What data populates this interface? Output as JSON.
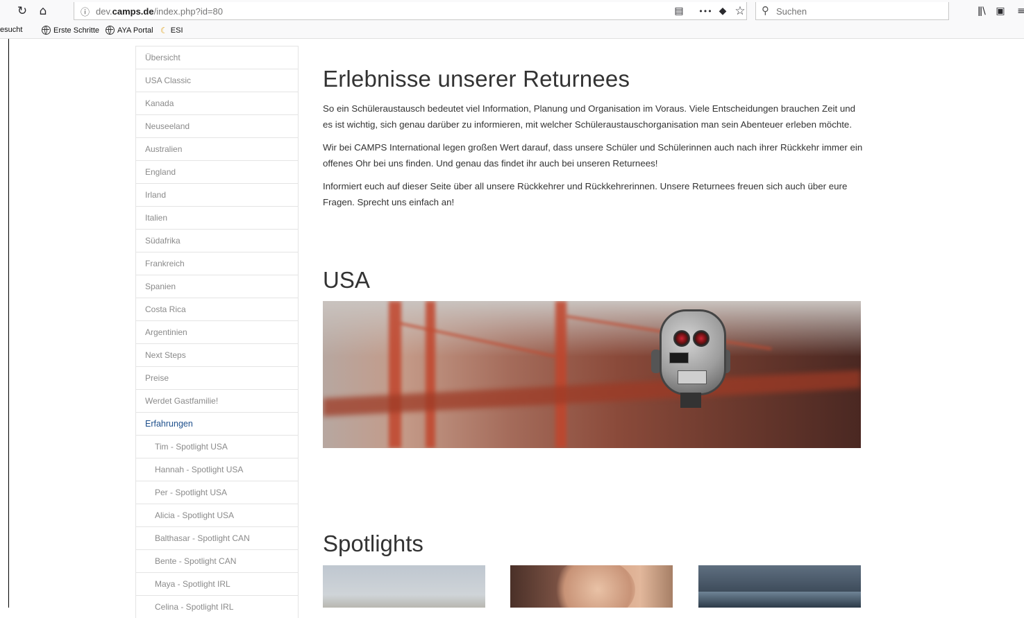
{
  "browser": {
    "url_prefix": "dev.",
    "url_domain": "camps.de",
    "url_path": "/index.php?id=80",
    "search_placeholder": "Suchen",
    "icons": {
      "reload": "↻",
      "home": "⌂",
      "info": "ⓘ",
      "reader": "▤",
      "more": "•••",
      "pocket": "◆",
      "star": "☆",
      "search": "⚲",
      "library": "ǁ\\",
      "sidebar": "▣",
      "menu": "≡"
    },
    "bookmarks": [
      {
        "label": "esucht"
      },
      {
        "label": "Erste Schritte"
      },
      {
        "label": "AYA Portal"
      },
      {
        "label": "ESI"
      }
    ]
  },
  "sidebar": {
    "items": [
      {
        "label": "Übersicht"
      },
      {
        "label": "USA Classic"
      },
      {
        "label": "Kanada"
      },
      {
        "label": "Neuseeland"
      },
      {
        "label": "Australien"
      },
      {
        "label": "England"
      },
      {
        "label": "Irland"
      },
      {
        "label": "Italien"
      },
      {
        "label": "Südafrika"
      },
      {
        "label": "Frankreich"
      },
      {
        "label": "Spanien"
      },
      {
        "label": "Costa Rica"
      },
      {
        "label": "Argentinien"
      },
      {
        "label": "Next Steps"
      },
      {
        "label": "Preise"
      },
      {
        "label": "Werdet Gastfamilie!"
      },
      {
        "label": "Erfahrungen"
      }
    ],
    "subitems": [
      {
        "label": "Tim - Spotlight USA"
      },
      {
        "label": "Hannah - Spotlight USA"
      },
      {
        "label": "Per - Spotlight USA"
      },
      {
        "label": "Alicia - Spotlight USA"
      },
      {
        "label": "Balthasar - Spotlight CAN"
      },
      {
        "label": "Bente - Spotlight CAN"
      },
      {
        "label": "Maya - Spotlight IRL"
      },
      {
        "label": "Celina - Spotlight IRL"
      }
    ],
    "active_item": "Erfahrungen"
  },
  "main": {
    "title": "Erlebnisse unserer Returnees",
    "paragraphs": [
      "So ein Schüleraustausch bedeutet viel Information, Planung und Organisation im Voraus. Viele Entscheidungen brauchen Zeit und es ist wichtig, sich genau darüber zu informieren, mit welcher Schüleraustauschorganisation man sein Abenteuer erleben möchte.",
      "Wir bei CAMPS International legen großen Wert darauf, dass unsere Schüler und Schülerinnen auch nach ihrer Rückkehr immer ein offenes Ohr bei uns finden. Und genau das findet ihr auch bei unseren Returnees!",
      "Informiert euch auf dieser Seite über all unsere Rückkehrer und Rückkehrerinnen. Unsere Returnees freuen sich auch über eure Fragen. Sprecht uns einfach an!"
    ],
    "section_usa": "USA",
    "section_spotlights": "Spotlights"
  },
  "colors": {
    "link_active": "#1d4f8c",
    "nav_text": "#8a8a8a",
    "body_text": "#333333",
    "border": "#e4e4e4"
  }
}
